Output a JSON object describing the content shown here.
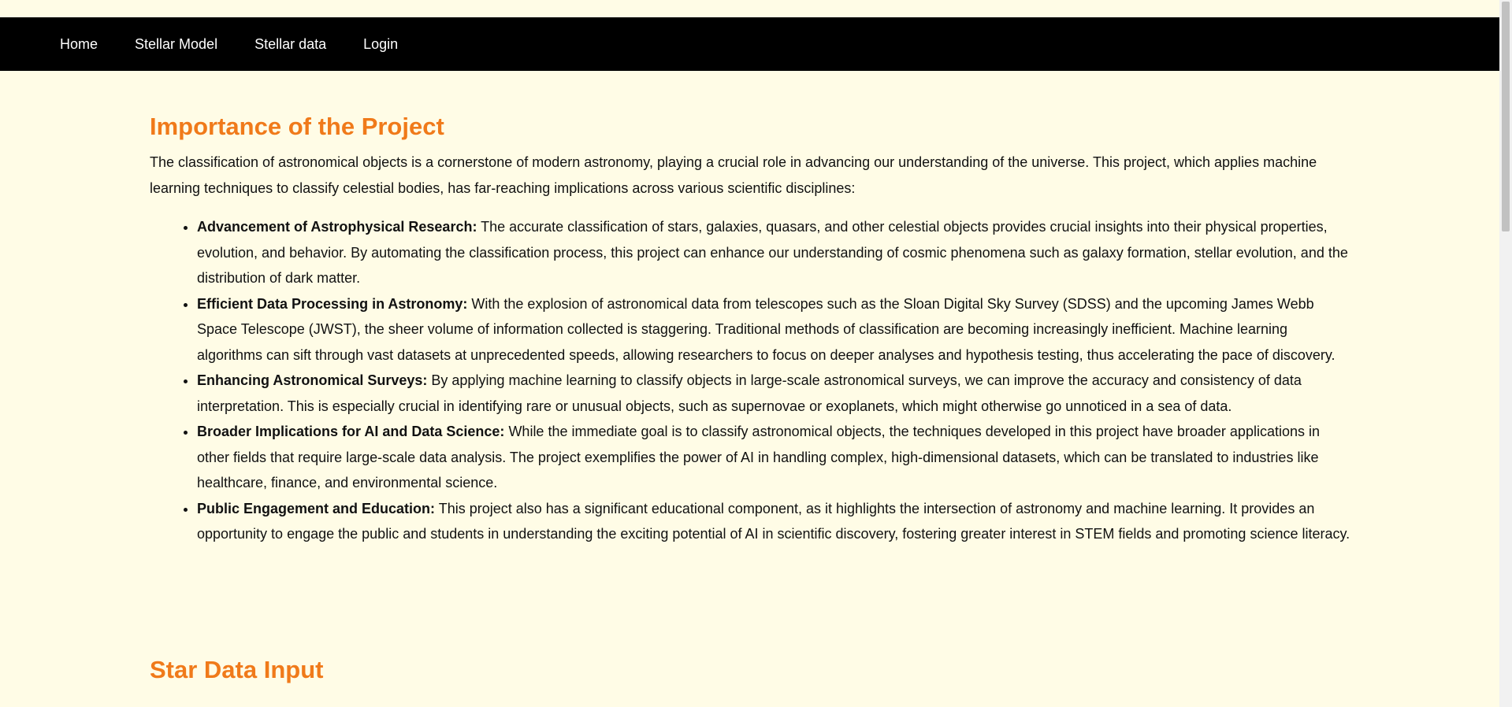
{
  "nav": {
    "items": [
      {
        "label": "Home"
      },
      {
        "label": "Stellar Model"
      },
      {
        "label": "Stellar data"
      },
      {
        "label": "Login"
      }
    ]
  },
  "section1": {
    "title": "Importance of the Project",
    "intro": "The classification of astronomical objects is a cornerstone of modern astronomy, playing a crucial role in advancing our understanding of the universe. This project, which applies machine learning techniques to classify celestial bodies, has far-reaching implications across various scientific disciplines:",
    "points": [
      {
        "heading": "Advancement of Astrophysical Research:",
        "text": " The accurate classification of stars, galaxies, quasars, and other celestial objects provides crucial insights into their physical properties, evolution, and behavior. By automating the classification process, this project can enhance our understanding of cosmic phenomena such as galaxy formation, stellar evolution, and the distribution of dark matter."
      },
      {
        "heading": "Efficient Data Processing in Astronomy:",
        "text": " With the explosion of astronomical data from telescopes such as the Sloan Digital Sky Survey (SDSS) and the upcoming James Webb Space Telescope (JWST), the sheer volume of information collected is staggering. Traditional methods of classification are becoming increasingly inefficient. Machine learning algorithms can sift through vast datasets at unprecedented speeds, allowing researchers to focus on deeper analyses and hypothesis testing, thus accelerating the pace of discovery."
      },
      {
        "heading": "Enhancing Astronomical Surveys:",
        "text": " By applying machine learning to classify objects in large-scale astronomical surveys, we can improve the accuracy and consistency of data interpretation. This is especially crucial in identifying rare or unusual objects, such as supernovae or exoplanets, which might otherwise go unnoticed in a sea of data."
      },
      {
        "heading": "Broader Implications for AI and Data Science:",
        "text": " While the immediate goal is to classify astronomical objects, the techniques developed in this project have broader applications in other fields that require large-scale data analysis. The project exemplifies the power of AI in handling complex, high-dimensional datasets, which can be translated to industries like healthcare, finance, and environmental science."
      },
      {
        "heading": "Public Engagement and Education:",
        "text": " This project also has a significant educational component, as it highlights the intersection of astronomy and machine learning. It provides an opportunity to engage the public and students in understanding the exciting potential of AI in scientific discovery, fostering greater interest in STEM fields and promoting science literacy."
      }
    ]
  },
  "section2": {
    "title": "Star Data Input"
  },
  "colors": {
    "background": "#fffce6",
    "navbar": "#000000",
    "heading": "#f07a1a"
  }
}
